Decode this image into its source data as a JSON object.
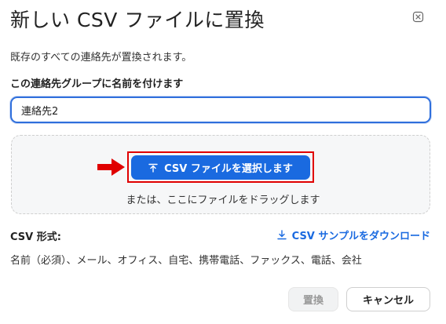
{
  "dialog": {
    "title": "新しい CSV ファイルに置換",
    "description": "既存のすべての連絡先が置換されます。",
    "close_icon": "close-icon"
  },
  "group_name": {
    "label": "この連絡先グループに名前を付けます",
    "value": "連絡先2"
  },
  "upload": {
    "choose_button_label": "CSV ファイルを選択します",
    "choose_icon": "upload-icon",
    "drag_text": "または、ここにファイルをドラッグします",
    "highlight_color": "#e00000"
  },
  "format": {
    "label": "CSV 形式:",
    "sample_link_label": "CSV サンプルをダウンロード",
    "sample_icon": "download-icon",
    "fields": "名前（必須）、メール、オフィス、自宅、携帯電話、ファックス、電話、会社"
  },
  "actions": {
    "replace_label": "置換",
    "cancel_label": "キャンセル"
  },
  "colors": {
    "accent": "#1a6ae0",
    "annotation_red": "#e00000"
  }
}
